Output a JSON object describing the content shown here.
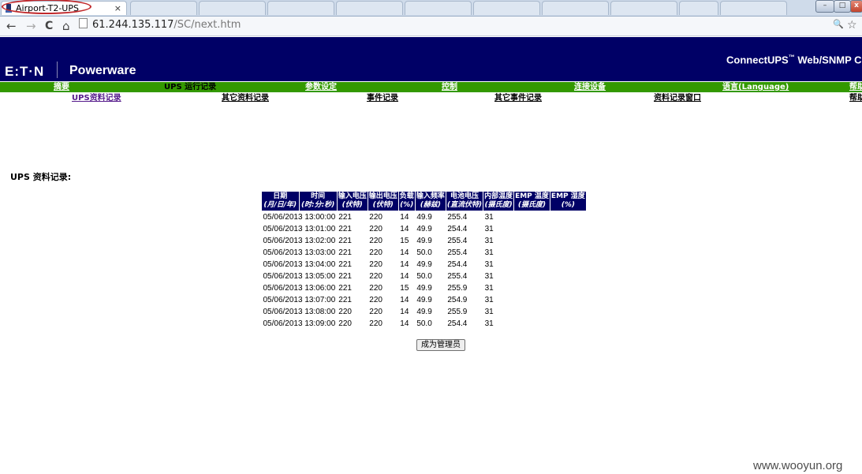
{
  "browser": {
    "active_tab_title": "Airport-T2-UPS",
    "tab_close_glyph": "×",
    "background_tabs": [
      "",
      "",
      "",
      "",
      "",
      "",
      "",
      "",
      "",
      ""
    ],
    "url_host": "61.244.135.117",
    "url_path": "/SC/next.htm"
  },
  "header": {
    "brand": "E:T·N",
    "subbrand": "Powerware",
    "product_title": "ConnectUPS",
    "product_tm": "™",
    "product_suffix": "Web/SNMP C"
  },
  "main_nav": [
    {
      "label": "摘要",
      "current": false
    },
    {
      "label": "UPS 运行记录",
      "current": true
    },
    {
      "label": "参数设定",
      "current": false
    },
    {
      "label": "控制",
      "current": false
    },
    {
      "label": "连接设备",
      "current": false
    },
    {
      "label": "语言(Language)",
      "current": false
    },
    {
      "label": "帮助",
      "current": false
    }
  ],
  "sub_nav": [
    {
      "label": "UPS资料记录",
      "current": true
    },
    {
      "label": "其它资料记录",
      "current": false
    },
    {
      "label": "事件记录",
      "current": false
    },
    {
      "label": "其它事件记录",
      "current": false
    },
    {
      "label": "资料记录窗口",
      "current": false
    },
    {
      "label": "帮助",
      "current": false
    }
  ],
  "section_title": "UPS 资料记录:",
  "table": {
    "columns": [
      {
        "name": "日期",
        "unit": "(月/日/年)"
      },
      {
        "name": "时间",
        "unit": "(时:分:秒)"
      },
      {
        "name": "输入电压",
        "unit": "(伏特)"
      },
      {
        "name": "输出电压",
        "unit": "(伏特)"
      },
      {
        "name": "负载",
        "unit": "(%)"
      },
      {
        "name": "输入频率",
        "unit": "(赫兹)"
      },
      {
        "name": "电池电压",
        "unit": "(直流伏特)"
      },
      {
        "name": "内部温度",
        "unit": "(摄氏度)"
      },
      {
        "name": "EMP 温度",
        "unit": "(摄氏度)"
      },
      {
        "name": "EMP 湿度",
        "unit": "(%)"
      }
    ],
    "rows": [
      {
        "datetime": "05/06/2013 13:00:00",
        "vin": "221",
        "vout": "220",
        "load": "14",
        "freq": "49.9",
        "battery": "255.4",
        "temp": "31"
      },
      {
        "datetime": "05/06/2013 13:01:00",
        "vin": "221",
        "vout": "220",
        "load": "14",
        "freq": "49.9",
        "battery": "254.4",
        "temp": "31"
      },
      {
        "datetime": "05/06/2013 13:02:00",
        "vin": "221",
        "vout": "220",
        "load": "15",
        "freq": "49.9",
        "battery": "255.4",
        "temp": "31"
      },
      {
        "datetime": "05/06/2013 13:03:00",
        "vin": "221",
        "vout": "220",
        "load": "14",
        "freq": "50.0",
        "battery": "255.4",
        "temp": "31"
      },
      {
        "datetime": "05/06/2013 13:04:00",
        "vin": "221",
        "vout": "220",
        "load": "14",
        "freq": "49.9",
        "battery": "254.4",
        "temp": "31"
      },
      {
        "datetime": "05/06/2013 13:05:00",
        "vin": "221",
        "vout": "220",
        "load": "14",
        "freq": "50.0",
        "battery": "255.4",
        "temp": "31"
      },
      {
        "datetime": "05/06/2013 13:06:00",
        "vin": "221",
        "vout": "220",
        "load": "15",
        "freq": "49.9",
        "battery": "255.9",
        "temp": "31"
      },
      {
        "datetime": "05/06/2013 13:07:00",
        "vin": "221",
        "vout": "220",
        "load": "14",
        "freq": "49.9",
        "battery": "254.9",
        "temp": "31"
      },
      {
        "datetime": "05/06/2013 13:08:00",
        "vin": "220",
        "vout": "220",
        "load": "14",
        "freq": "49.9",
        "battery": "255.9",
        "temp": "31"
      },
      {
        "datetime": "05/06/2013 13:09:00",
        "vin": "220",
        "vout": "220",
        "load": "14",
        "freq": "50.0",
        "battery": "254.4",
        "temp": "31"
      }
    ]
  },
  "admin_button_label": "成为管理员",
  "watermark": "www.wooyun.org",
  "colors": {
    "banner": "#000066",
    "nav_bar": "#339900",
    "table_header": "#000066",
    "tab_highlight": "#c0282b"
  },
  "icons": {
    "back": "←",
    "forward": "→",
    "reload": "C",
    "home": "⌂",
    "zoom": "🔍",
    "bookmark": "☆",
    "minimize": "–",
    "maximize": "□",
    "close": "x"
  }
}
